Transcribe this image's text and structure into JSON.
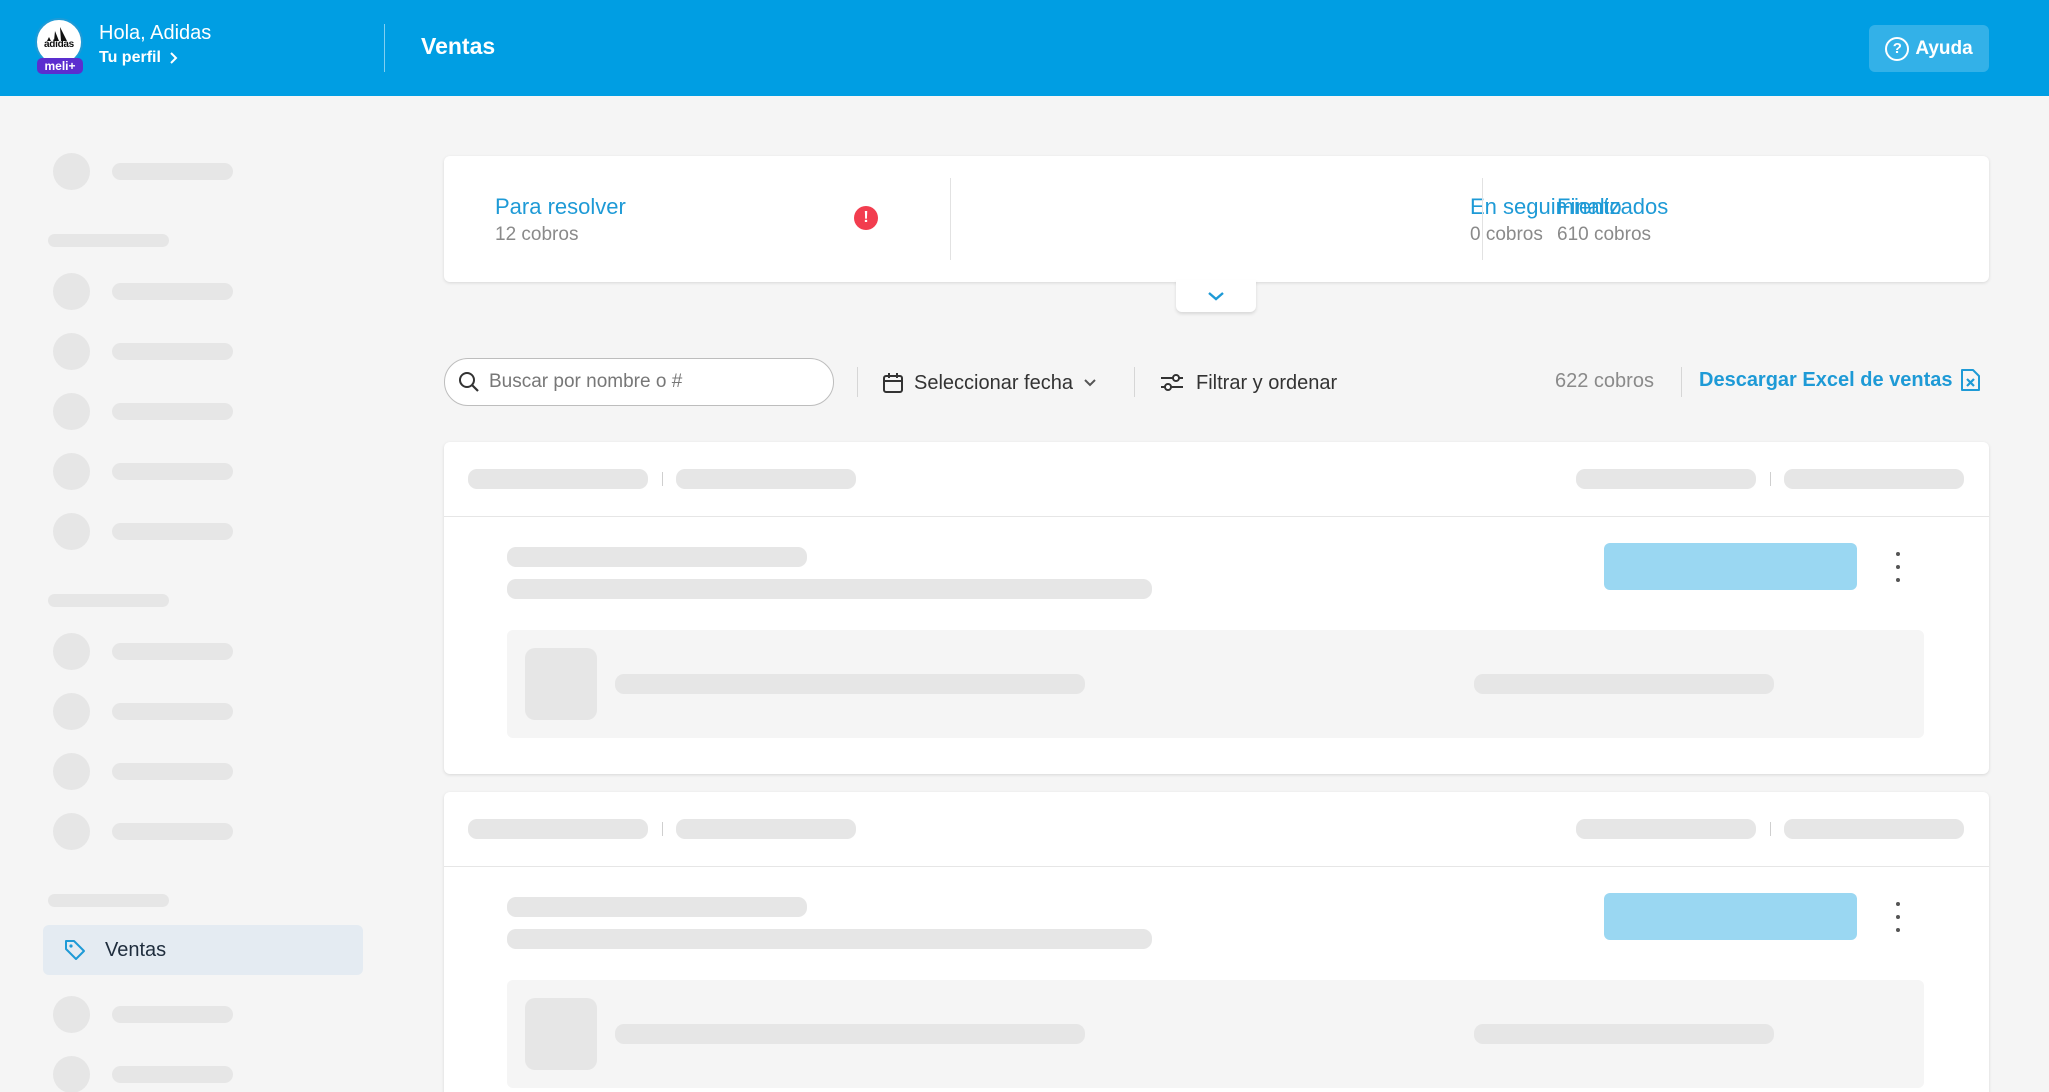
{
  "header": {
    "brand_text": "adidas",
    "badge": "meli+",
    "greeting": "Hola, Adidas",
    "profile_link": "Tu perfil",
    "page_title": "Ventas",
    "help_label": "Ayuda",
    "help_icon": "question-circle-icon",
    "brand_color": "#009ee3"
  },
  "sidebar": {
    "active_item": {
      "label": "Ventas",
      "icon": "tag-icon"
    }
  },
  "status": {
    "items": [
      {
        "title": "Para resolver",
        "count": "12 cobros",
        "alert": "!"
      },
      {
        "title": "En seguimiento",
        "count": "0 cobros"
      },
      {
        "title": "Finalizados",
        "count": "610 cobros"
      }
    ],
    "expand_icon": "chevron-down-icon",
    "alert_color": "#f23d4f",
    "accent_color": "#1e9ad6"
  },
  "toolbar": {
    "search_placeholder": "Buscar por nombre o #",
    "date_label": "Seleccionar fecha",
    "filter_label": "Filtrar y ordenar",
    "count": "622 cobros",
    "download_label": "Descargar Excel de ventas"
  }
}
